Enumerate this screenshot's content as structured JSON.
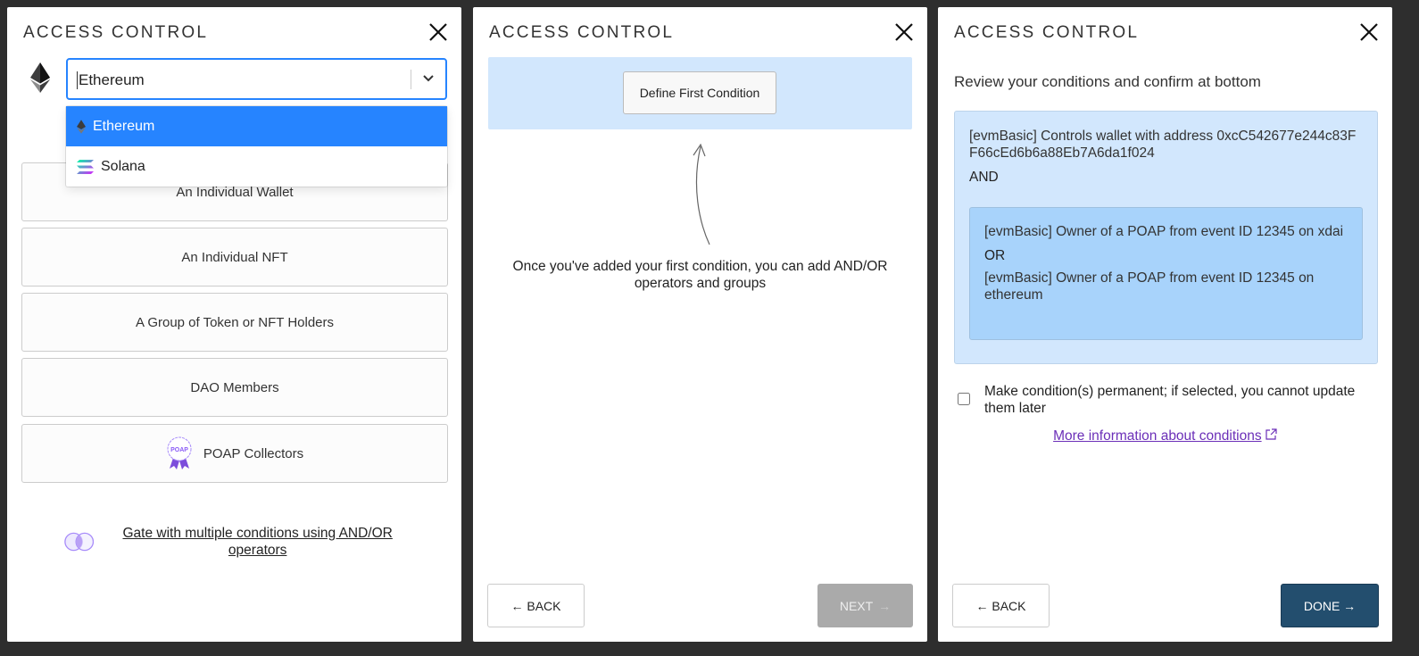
{
  "colors": {
    "background": "#2e2e2e",
    "select_focus": "#2684ff",
    "condition_box": "#d2e7fd",
    "group_box": "#a8d3fb",
    "done_button": "#234e6e",
    "link": "#6b2fb8",
    "poap_purple": "#8b5cf6"
  },
  "panel1": {
    "title": "ACCESS CONTROL",
    "chain_select": {
      "value": "Ethereum",
      "icon": "ethereum-icon",
      "options": [
        {
          "label": "Ethereum",
          "icon": "ethereum-icon",
          "selected": true
        },
        {
          "label": "Solana",
          "icon": "solana-icon",
          "selected": false
        }
      ]
    },
    "choices": [
      {
        "label": "An Individual Wallet"
      },
      {
        "label": "An Individual NFT"
      },
      {
        "label": "A Group of Token or NFT Holders"
      },
      {
        "label": "DAO Members"
      },
      {
        "label": "POAP Collectors",
        "icon": "poap-badge-icon",
        "icon_text": "POAP"
      }
    ],
    "gate_link": "Gate with multiple conditions using AND/OR operators"
  },
  "panel2": {
    "title": "ACCESS CONTROL",
    "define_button": "Define First Condition",
    "hint": "Once you've added your first condition, you can add AND/OR operators and groups",
    "back": "← BACK",
    "next": "NEXT",
    "next_arrow": "→"
  },
  "panel3": {
    "title": "ACCESS CONTROL",
    "review": "Review your conditions and confirm at bottom",
    "condition1": "[evmBasic] Controls wallet with address 0xcC542677e244c83FF66cEd6b6a88Eb7A6da1f024",
    "operator1": "AND",
    "group": {
      "condition1": "[evmBasic] Owner of a POAP from event ID 12345 on xdai",
      "operator": "OR",
      "condition2": "[evmBasic] Owner of a POAP from event ID 12345 on ethereum"
    },
    "permanent_label": "Make condition(s) permanent; if selected, you cannot update them later",
    "permanent_checked": false,
    "more_link": "More information about conditions",
    "back": "← BACK",
    "done": "DONE →"
  }
}
